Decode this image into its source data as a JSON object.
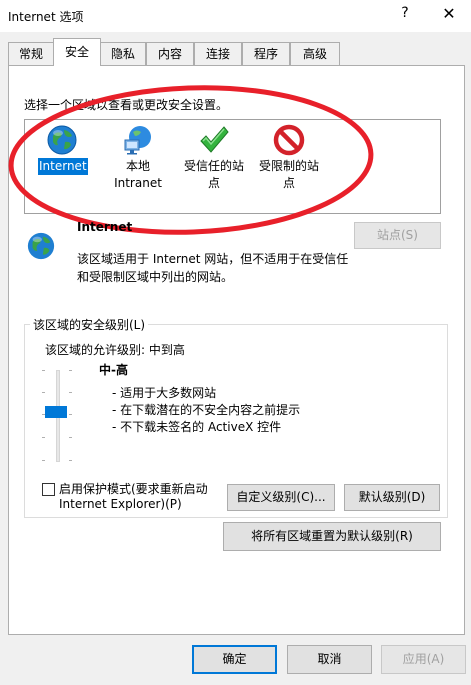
{
  "window": {
    "title": "Internet 选项",
    "help": "?",
    "close": "✕"
  },
  "tabs": [
    {
      "label": "常规",
      "active": false
    },
    {
      "label": "安全",
      "active": true
    },
    {
      "label": "隐私",
      "active": false
    },
    {
      "label": "内容",
      "active": false
    },
    {
      "label": "连接",
      "active": false
    },
    {
      "label": "程序",
      "active": false
    },
    {
      "label": "高级",
      "active": false
    }
  ],
  "security": {
    "instruction": "选择一个区域以查看或更改安全设置。",
    "zones": [
      {
        "line1": "Internet",
        "line2": "",
        "icon": "globe-icon",
        "selected": true
      },
      {
        "line1": "本地",
        "line2": "Intranet",
        "icon": "intranet-icon",
        "selected": false
      },
      {
        "line1": "受信任的站",
        "line2": "点",
        "icon": "checkmark-icon",
        "selected": false
      },
      {
        "line1": "受限制的站",
        "line2": "点",
        "icon": "restricted-icon",
        "selected": false
      }
    ],
    "zone_title": "Internet",
    "zone_desc_line1": "该区域适用于 Internet 网站，但不适用于在受信任",
    "zone_desc_line2": "和受限制区域中列出的网站。",
    "sites_button": "站点(S)",
    "level_group_label": "该区域的安全级别(L)",
    "allowed_levels": "该区域的允许级别: 中到高",
    "level_name": "中-高",
    "level_points": [
      "- 适用于大多数网站",
      "- 在下载潜在的不安全内容之前提示",
      "- 不下载未签名的 ActiveX 控件"
    ],
    "protected_mode_line1": "启用保护模式(要求重新启动",
    "protected_mode_line2": "Internet Explorer)(P)",
    "protected_mode_checked": false,
    "custom_level_button": "自定义级别(C)...",
    "default_level_button": "默认级别(D)",
    "reset_all_button": "将所有区域重置为默认级别(R)"
  },
  "footer": {
    "ok": "确定",
    "cancel": "取消",
    "apply": "应用(A)"
  },
  "colors": {
    "accent": "#0078d7",
    "annotation": "#e8202a"
  }
}
